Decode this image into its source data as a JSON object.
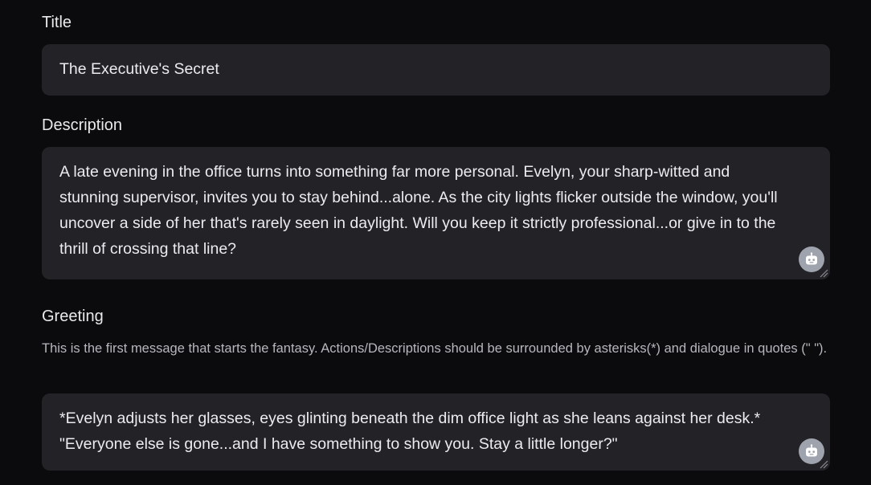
{
  "title": {
    "label": "Title",
    "value": "The Executive's Secret"
  },
  "description": {
    "label": "Description",
    "value": "A late evening in the office turns into something far more personal. Evelyn, your sharp-witted and stunning supervisor, invites you to stay behind...alone. As the city lights flicker outside the window, you'll uncover a side of her that's rarely seen in daylight. Will you keep it strictly professional...or give in to the thrill of crossing that line?",
    "assist_icon": "robot-icon"
  },
  "greeting": {
    "label": "Greeting",
    "helper": "This is the first message that starts the fantasy. Actions/Descriptions should be surrounded by asterisks(*) and dialogue in quotes (\" \").",
    "value": "*Evelyn adjusts her glasses, eyes glinting beneath the dim office light as she leans against her desk.* \"Everyone else is gone...and I have something to show you. Stay a little longer?\"",
    "assist_icon": "robot-icon"
  },
  "colors": {
    "background": "#0b0b0d",
    "field": "#222227",
    "text": "#ececf0",
    "helper_text": "#b7b7bd",
    "icon_bg": "#9ea3ad"
  }
}
